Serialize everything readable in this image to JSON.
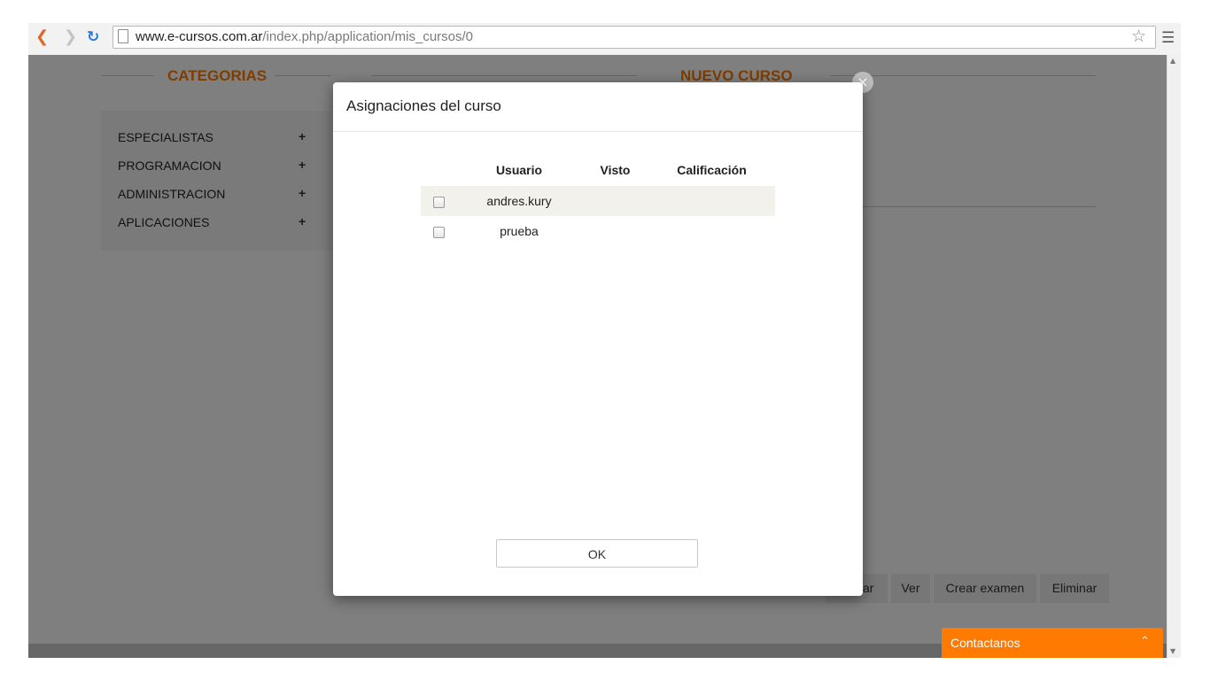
{
  "browser": {
    "url_host": "www.e-cursos.com.ar",
    "url_path": "/index.php/application/mis_cursos/0"
  },
  "page": {
    "categories_title": "CATEGORIAS",
    "new_course_title": "NUEVO CURSO",
    "categories": [
      {
        "label": "ESPECIALISTAS",
        "expand": "+"
      },
      {
        "label": "PROGRAMACION",
        "expand": "+"
      },
      {
        "label": "ADMINISTRACION",
        "expand": "+"
      },
      {
        "label": "APLICACIONES",
        "expand": "+"
      }
    ],
    "actions": {
      "edit_partial": "ar",
      "view": "Ver",
      "create_exam": "Crear examen",
      "delete": "Eliminar"
    }
  },
  "modal": {
    "title": "Asignaciones del curso",
    "columns": [
      "Usuario",
      "Visto",
      "Calificación"
    ],
    "rows": [
      {
        "user": "andres.kury",
        "visto": "",
        "calificacion": "",
        "checked": false
      },
      {
        "user": "prueba",
        "visto": "",
        "calificacion": "",
        "checked": false
      }
    ],
    "ok_label": "OK"
  },
  "contact": {
    "label": "Contactanos",
    "icon": "chevron-up-icon"
  },
  "colors": {
    "accent": "#ff7a00"
  }
}
